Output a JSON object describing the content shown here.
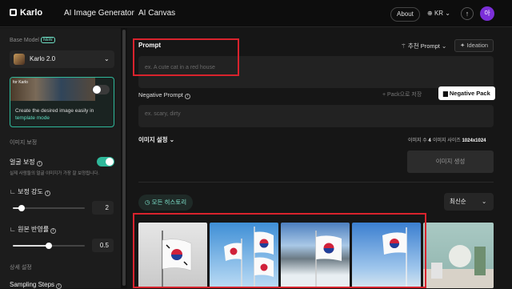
{
  "header": {
    "logo": "Karlo",
    "tabs": [
      "AI Image Generator",
      "AI Canvas"
    ],
    "about": "About",
    "lang": "KR",
    "avatar": "아"
  },
  "sidebar": {
    "base_model_label": "Base Model",
    "new_badge": "NEW",
    "model": "Karlo 2.0",
    "template_tag": "for Karlo",
    "template_text": "Create the desired image easily in",
    "template_link": "template mode",
    "section_image": "이미지 보정",
    "face_correction": "얼굴 보정",
    "face_helper": "실제 사람들의 얼굴 이미지가 가장 잘 보정됩니다.",
    "strength_label": "보정 강도",
    "strength_value": "2",
    "strength_fraction": 0.12,
    "original_label": "원본 반영률",
    "original_value": "0.5",
    "original_fraction": 0.5,
    "section_detail": "상세 설정",
    "sampling_steps": "Sampling Steps"
  },
  "main": {
    "prompt_label": "Prompt",
    "prompt_placeholder": "ex. A cute cat in a red house",
    "recommended": "추천 Prompt",
    "ideation": "Ideation",
    "negative_label": "Negative Prompt",
    "pack_save": "+ Pack으로 저장",
    "negative_pack": "Negative Pack",
    "negative_placeholder": "ex. scary, dirty",
    "settings_label": "이미지 설정",
    "count_label": "이미지 수",
    "count_value": "4",
    "size_label": "이미지 사이즈",
    "size_value": "1024x1024",
    "generate": "이미지 생성",
    "history": "모든 히스토리",
    "sort": "최신순"
  },
  "colors": {
    "accent": "#2fb89a",
    "highlight": "#d9232d",
    "avatar": "#7b2fd8"
  }
}
